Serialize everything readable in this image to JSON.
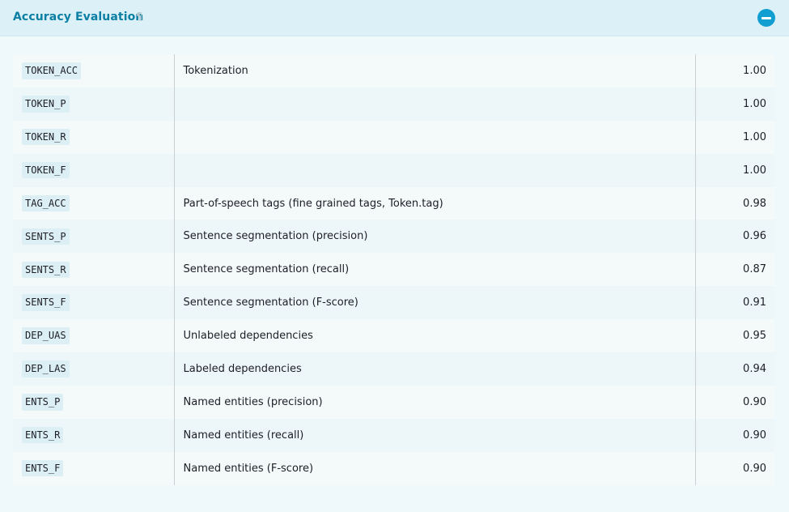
{
  "header": {
    "title": "Accuracy Evaluation",
    "pilcrow": "¶"
  },
  "rows": [
    {
      "key": "TOKEN_ACC",
      "description": "Tokenization",
      "value": "1.00"
    },
    {
      "key": "TOKEN_P",
      "description": "",
      "value": "1.00"
    },
    {
      "key": "TOKEN_R",
      "description": "",
      "value": "1.00"
    },
    {
      "key": "TOKEN_F",
      "description": "",
      "value": "1.00"
    },
    {
      "key": "TAG_ACC",
      "description": "Part-of-speech tags (fine grained tags, Token.tag)",
      "value": "0.98"
    },
    {
      "key": "SENTS_P",
      "description": "Sentence segmentation (precision)",
      "value": "0.96"
    },
    {
      "key": "SENTS_R",
      "description": "Sentence segmentation (recall)",
      "value": "0.87"
    },
    {
      "key": "SENTS_F",
      "description": "Sentence segmentation (F-score)",
      "value": "0.91"
    },
    {
      "key": "DEP_UAS",
      "description": "Unlabeled dependencies",
      "value": "0.95"
    },
    {
      "key": "DEP_LAS",
      "description": "Labeled dependencies",
      "value": "0.94"
    },
    {
      "key": "ENTS_P",
      "description": "Named entities (precision)",
      "value": "0.90"
    },
    {
      "key": "ENTS_R",
      "description": "Named entities (recall)",
      "value": "0.90"
    },
    {
      "key": "ENTS_F",
      "description": "Named entities (F-score)",
      "value": "0.90"
    }
  ],
  "icons": {
    "collapse": "minus-circle-icon"
  },
  "colors": {
    "title": "#0b7fa3",
    "collapse_button": "#119ed0",
    "header_bg": "#dcf0f7",
    "panel_bg": "#eff8fb",
    "badge_bg": "#dceff4"
  }
}
